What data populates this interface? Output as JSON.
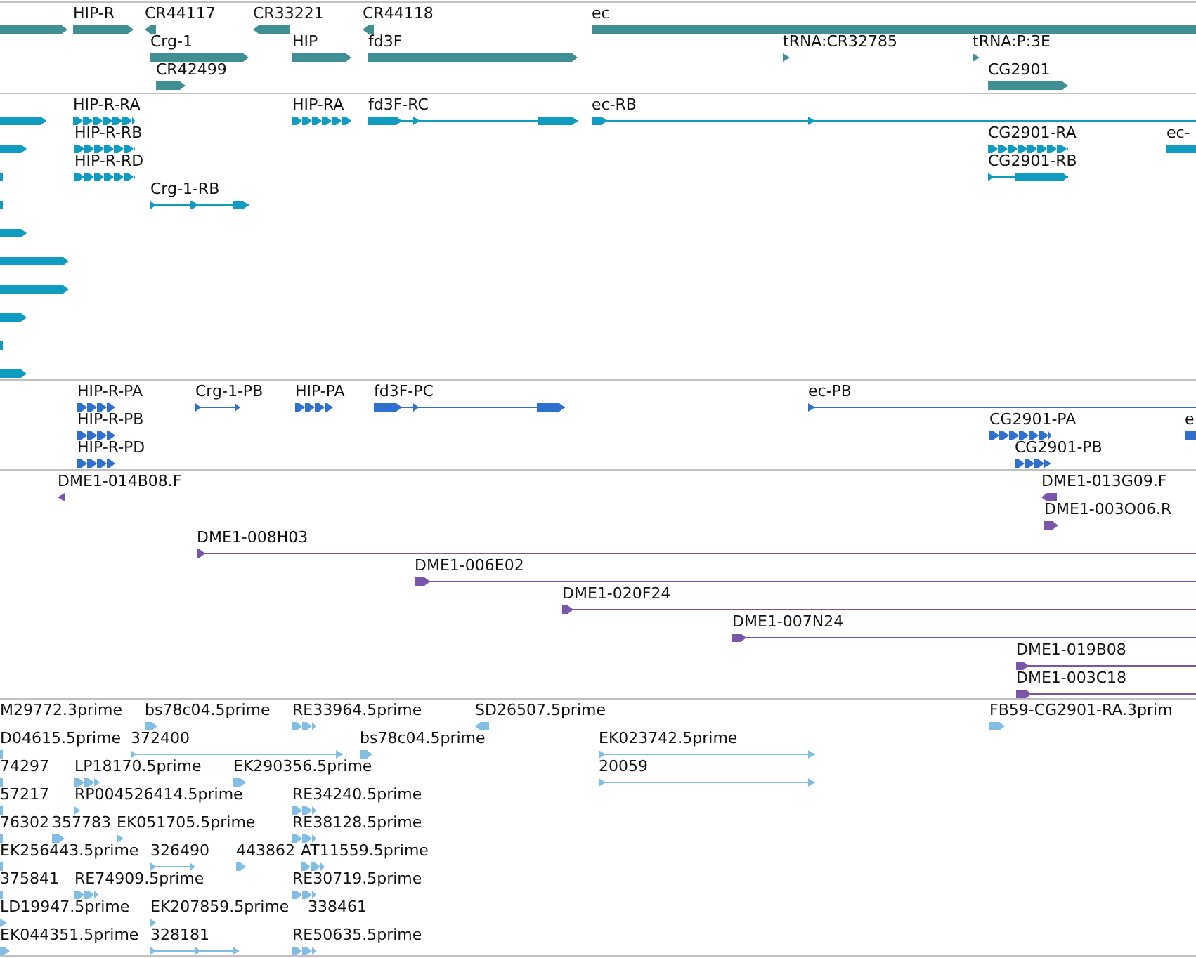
{
  "tracks": [
    {
      "kind": "gene",
      "features": [
        {
          "label": "HIP-R"
        },
        {
          "label": "CR44117"
        },
        {
          "label": "CR33221"
        },
        {
          "label": "CR44118"
        },
        {
          "label": "ec"
        },
        {
          "label": "Crg-1"
        },
        {
          "label": "HIP"
        },
        {
          "label": "fd3F"
        },
        {
          "label": "tRNA:CR32785"
        },
        {
          "label": "tRNA:P:3E"
        },
        {
          "label": "CR42499"
        },
        {
          "label": "CG2901"
        }
      ]
    },
    {
      "kind": "transcript",
      "features": [
        {
          "label": "HIP-R-RA"
        },
        {
          "label": "HIP-RA"
        },
        {
          "label": "fd3F-RC"
        },
        {
          "label": "ec-RB"
        },
        {
          "label": "HIP-R-RB"
        },
        {
          "label": "CG2901-RA"
        },
        {
          "label": "ec-"
        },
        {
          "label": "HIP-R-RD"
        },
        {
          "label": "CG2901-RB"
        },
        {
          "label": "Crg-1-RB"
        }
      ]
    },
    {
      "kind": "protein",
      "features": [
        {
          "label": "HIP-R-PA"
        },
        {
          "label": "Crg-1-PB"
        },
        {
          "label": "HIP-PA"
        },
        {
          "label": "fd3F-PC"
        },
        {
          "label": "ec-PB"
        },
        {
          "label": "HIP-R-PB"
        },
        {
          "label": "CG2901-PA"
        },
        {
          "label": "e"
        },
        {
          "label": "HIP-R-PD"
        },
        {
          "label": "CG2901-PB"
        }
      ]
    },
    {
      "kind": "clone",
      "features": [
        {
          "label": "DME1-014B08.F"
        },
        {
          "label": "DME1-013G09.F"
        },
        {
          "label": "DME1-003O06.R"
        },
        {
          "label": "DME1-008H03"
        },
        {
          "label": "DME1-006E02"
        },
        {
          "label": "DME1-020F24"
        },
        {
          "label": "DME1-007N24"
        },
        {
          "label": "DME1-019B08"
        },
        {
          "label": "DME1-003C18"
        }
      ]
    },
    {
      "kind": "est",
      "features": [
        {
          "label": "M29772.3prime"
        },
        {
          "label": "bs78c04.5prime"
        },
        {
          "label": "RE33964.5prime"
        },
        {
          "label": "SD26507.5prime"
        },
        {
          "label": "FB59-CG2901-RA.3prim"
        },
        {
          "label": "D04615.5prime"
        },
        {
          "label": "372400"
        },
        {
          "label": "bs78c04.5prime"
        },
        {
          "label": "EK023742.5prime"
        },
        {
          "label": "74297"
        },
        {
          "label": "LP18170.5prime"
        },
        {
          "label": "EK290356.5prime"
        },
        {
          "label": "20059"
        },
        {
          "label": "57217"
        },
        {
          "label": "RP004526414.5prime"
        },
        {
          "label": "RE34240.5prime"
        },
        {
          "label": "76302"
        },
        {
          "label": "357783"
        },
        {
          "label": "EK051705.5prime"
        },
        {
          "label": "RE38128.5prime"
        },
        {
          "label": "EK256443.5prime"
        },
        {
          "label": "326490"
        },
        {
          "label": "443862"
        },
        {
          "label": "AT11559.5prime"
        },
        {
          "label": "375841"
        },
        {
          "label": "RE74909.5prime"
        },
        {
          "label": "RE30719.5prime"
        },
        {
          "label": "LD19947.5prime"
        },
        {
          "label": "EK207859.5prime"
        },
        {
          "label": "338461"
        },
        {
          "label": "EK044351.5prime"
        },
        {
          "label": "328181"
        },
        {
          "label": "RE50635.5prime"
        }
      ]
    }
  ]
}
